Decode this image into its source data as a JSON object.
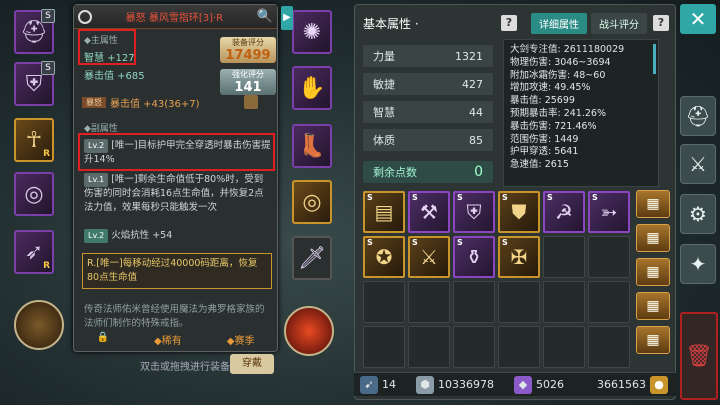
{
  "tooltip": {
    "title": "暴怒 暴风雪指环[3]·R",
    "main_attr_title": "◆主属性",
    "main_attr_1": "智慧 +127",
    "main_attr_2": "暴击值 +685",
    "score_label": "装备评分",
    "score_value": "17499",
    "enhance_label": "强化评分",
    "enhance_value": "141",
    "rage_tag": "暴怒",
    "rage_line": "暴击值 +43(36+7)",
    "sub_attr_title": "◆副属性",
    "sub1_lv": "Lv.2",
    "sub1_text": "[唯一]目标护甲完全穿透时暴击伤害提升14%",
    "sub2_lv": "Lv.1",
    "sub2_text": "[唯一]剩余生命值低于80%时，受到伤害的同时会消耗16点生命值，并恢复2点法力值，效果每秒只能触发一次",
    "sub3_lv": "Lv.2",
    "sub3_text": "火焰抗性 +54",
    "unique_text": "R.[唯一]每移动经过40000码距离，恢复80点生命值",
    "lore": "传奇法师佑米曾经使用魔法为弗罗格家族的法师们制作的特殊戒指。",
    "rarity": "◆稀有",
    "season": "◆赛季"
  },
  "hint": "双击或拖拽进行装备",
  "wear_btn": "穿戴",
  "stats": {
    "title": "基本属性 ·",
    "tab_detail": "详细属性",
    "tab_battle": "战斗评分",
    "base": [
      {
        "label": "力量",
        "value": "1321"
      },
      {
        "label": "敏捷",
        "value": "427"
      },
      {
        "label": "智慧",
        "value": "44"
      },
      {
        "label": "体质",
        "value": "85"
      }
    ],
    "remain_label": "剩余点数",
    "remain_value": "0",
    "detail": [
      "大剑专注值: 2611180029",
      "物理伤害: 3046~3694",
      "附加冰霜伤害: 48~60",
      "增加攻速: 49.45%",
      "暴击值: 25699",
      "预期暴击率: 241.26%",
      "暴击伤害: 721.46%",
      "范围伤害: 1449",
      "护甲穿透: 5641",
      "急速值: 2615"
    ]
  },
  "bottom": {
    "arrows": "14",
    "silver": "10336978",
    "gems": "5026",
    "gold": "3661563"
  },
  "colors": {
    "accent": "#2fa7a7",
    "rare_border": "#8a46c0",
    "legend_border": "#c9952b",
    "highlight": "#e02020"
  }
}
